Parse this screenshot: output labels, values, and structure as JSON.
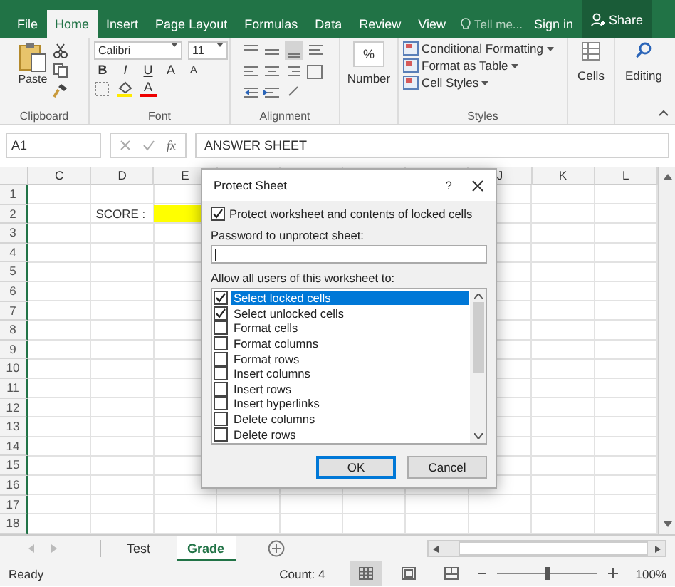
{
  "ribbon_tabs": [
    {
      "label": "File",
      "selected": false
    },
    {
      "label": "Home",
      "selected": true
    },
    {
      "label": "Insert",
      "selected": false
    },
    {
      "label": "Page Layout",
      "selected": false
    },
    {
      "label": "Formulas",
      "selected": false
    },
    {
      "label": "Data",
      "selected": false
    },
    {
      "label": "Review",
      "selected": false
    },
    {
      "label": "View",
      "selected": false
    }
  ],
  "tell_me": "Tell me...",
  "sign_in": "Sign in",
  "share": "Share",
  "clipboard": {
    "label": "Clipboard",
    "paste": "Paste"
  },
  "font": {
    "label": "Font",
    "name": "Calibri",
    "size": "11",
    "bold": "B",
    "italic": "I",
    "underline": "U",
    "grow": "A",
    "shrink": "A",
    "font_color": "A"
  },
  "alignment": {
    "label": "Alignment"
  },
  "number": {
    "symbol": "%",
    "button": "Number"
  },
  "styles": {
    "label": "Styles",
    "items": [
      "Conditional Formatting",
      "Format as Table",
      "Cell Styles"
    ]
  },
  "cells": {
    "button": "Cells"
  },
  "editing": {
    "button": "Editing"
  },
  "formula_bar": {
    "name_box": "A1",
    "fx": "fx",
    "value": "ANSWER SHEET"
  },
  "sheet": {
    "columns": [
      "C",
      "D",
      "E",
      null,
      null,
      null,
      null,
      "J",
      "K",
      "L"
    ],
    "rows": [
      {
        "number": "1"
      },
      {
        "number": "2",
        "cells": [
          null,
          {
            "text": "SCORE :"
          },
          {
            "color": "#ffff00"
          }
        ]
      },
      {
        "number": "3"
      },
      {
        "number": "4"
      },
      {
        "number": "5"
      },
      {
        "number": "6"
      },
      {
        "number": "7"
      },
      {
        "number": "8"
      },
      {
        "number": "9"
      },
      {
        "number": "10"
      },
      {
        "number": "11"
      },
      {
        "number": "12"
      },
      {
        "number": "13"
      },
      {
        "number": "14"
      },
      {
        "number": "15"
      },
      {
        "number": "16"
      },
      {
        "number": "17"
      },
      {
        "number": "18"
      }
    ]
  },
  "dialog": {
    "title": "Protect Sheet",
    "help": "?",
    "protect": {
      "label": "Protect worksheet and contents of locked cells",
      "checked": true
    },
    "password_label": "Password to unprotect sheet:",
    "allow_label": "Allow all users of this worksheet to:",
    "permissions": [
      {
        "label": "Select locked cells",
        "checked": true,
        "selected": true
      },
      {
        "label": "Select unlocked cells",
        "checked": true,
        "selected": false
      },
      {
        "label": "Format cells",
        "checked": false,
        "selected": false
      },
      {
        "label": "Format columns",
        "checked": false,
        "selected": false
      },
      {
        "label": "Format rows",
        "checked": false,
        "selected": false
      },
      {
        "label": "Insert columns",
        "checked": false,
        "selected": false
      },
      {
        "label": "Insert rows",
        "checked": false,
        "selected": false
      },
      {
        "label": "Insert hyperlinks",
        "checked": false,
        "selected": false
      },
      {
        "label": "Delete columns",
        "checked": false,
        "selected": false
      },
      {
        "label": "Delete rows",
        "checked": false,
        "selected": false
      }
    ],
    "buttons": [
      {
        "label": "OK",
        "selected": true
      },
      {
        "label": "Cancel",
        "selected": false
      }
    ]
  },
  "sheet_tabs": [
    {
      "label": "Test",
      "selected": false
    },
    {
      "label": "Grade",
      "selected": true
    }
  ],
  "status_bar": {
    "status": "Ready",
    "count": "Count: 4",
    "views": [
      {
        "kind": "normal",
        "selected": true
      },
      {
        "kind": "page-layout",
        "selected": false
      },
      {
        "kind": "page-break",
        "selected": false
      }
    ],
    "zoom": {
      "level": 0.5
    },
    "zoom_label": "100%"
  }
}
